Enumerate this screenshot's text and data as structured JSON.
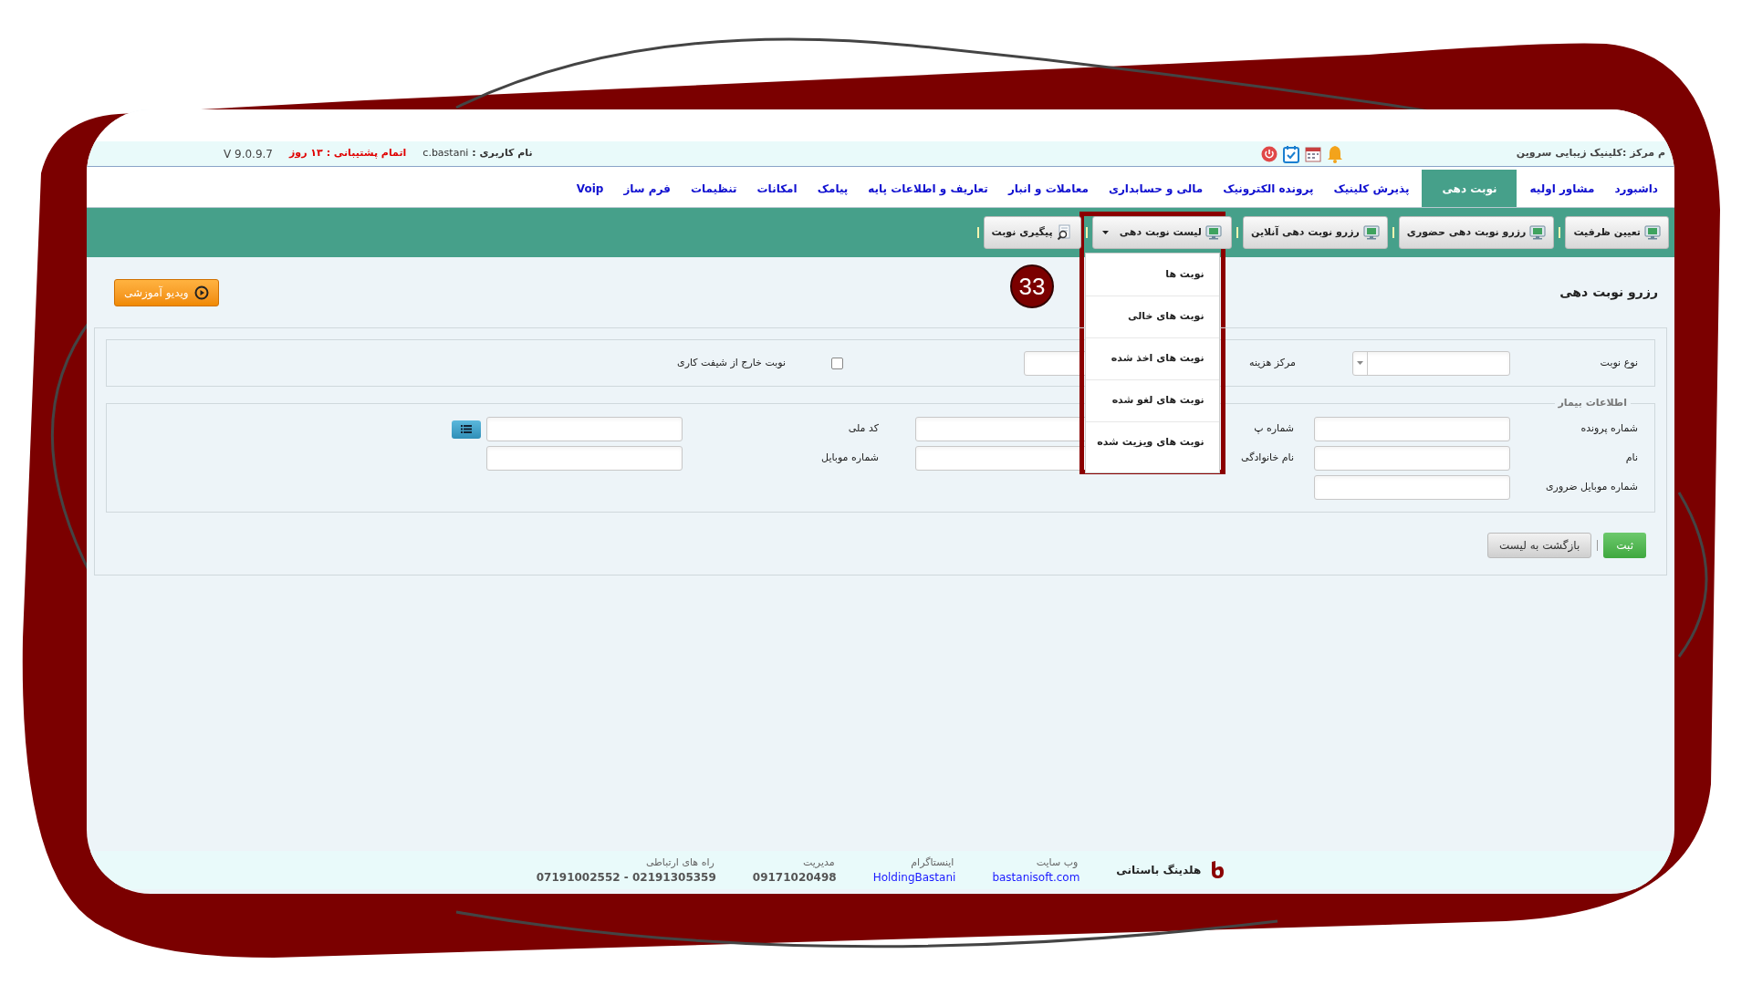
{
  "header": {
    "center_name": "م مرکز :کلینیک زیبایی سروین",
    "username_label": "نام کاربری :",
    "username": "c.bastani",
    "support": "اتمام پشتیبانی : ۱۳ روز",
    "version": "V 9.0.9.7"
  },
  "nav_tabs": [
    {
      "label": "داشبورد",
      "selected": false
    },
    {
      "label": "مشاور اولیه",
      "selected": false
    },
    {
      "label": "نوبت دهی",
      "selected": true
    },
    {
      "label": "پذیرش کلینیک",
      "selected": false
    },
    {
      "label": "پرونده الکترونیک",
      "selected": false
    },
    {
      "label": "مالی و حسابداری",
      "selected": false
    },
    {
      "label": "معاملات و انبار",
      "selected": false
    },
    {
      "label": "تعاریف و اطلاعات پایه",
      "selected": false
    },
    {
      "label": "پیامک",
      "selected": false
    },
    {
      "label": "امکانات",
      "selected": false
    },
    {
      "label": "تنظیمات",
      "selected": false
    },
    {
      "label": "فرم ساز",
      "selected": false
    },
    {
      "label": "Voip",
      "selected": false
    }
  ],
  "toolbar": [
    {
      "label": "تعیین ظرفیت",
      "kind": "monitor"
    },
    {
      "label": "رزرو نوبت دهی حضوری",
      "kind": "monitor"
    },
    {
      "label": "رزرو نوبت دهی آنلاین",
      "kind": "monitor"
    },
    {
      "label": "لیست نوبت دهی",
      "kind": "dropdown",
      "expanded": true
    },
    {
      "label": "پیگیری نوبت",
      "kind": "lookup"
    }
  ],
  "dropdown_menu": [
    "نوبت ها",
    "نوبت های خالی",
    "نوبت های اخذ شده",
    "نوبت های لغو شده",
    "نوبت های ویزیت شده"
  ],
  "step_badge": "33",
  "page_title": "رزرو نوبت دهی",
  "video_button": "ویدیو آموزشی",
  "filter": [
    {
      "label": "نوع نوبت",
      "kind": "select"
    },
    {
      "label": "مرکز هزینه",
      "kind": "text"
    },
    {
      "label": "نوبت خارج از شیفت کاری",
      "kind": "checkbox",
      "checked": false
    }
  ],
  "patient": {
    "legend": "اطلاعات بیمار",
    "rows": [
      [
        {
          "label": "شماره پرونده",
          "kind": "text"
        },
        {
          "label": "شماره پ",
          "kind": "text"
        },
        {
          "label": "کد ملی",
          "kind": "lookup"
        }
      ],
      [
        {
          "label": "نام",
          "kind": "text"
        },
        {
          "label": "نام خانوادگی",
          "kind": "text"
        },
        {
          "label": "شماره موبایل",
          "kind": "text"
        }
      ],
      [
        {
          "label": "شماره موبایل ضروری",
          "kind": "text"
        }
      ]
    ]
  },
  "actions": [
    {
      "label": "ثبت",
      "kind": "primary"
    },
    {
      "label": "بازگشت به لیست",
      "kind": "secondary"
    }
  ],
  "footer": {
    "company": "هلدینگ باستانی",
    "contacts": [
      {
        "label": "وب سایت",
        "value": "bastanisoft.com",
        "kind": "link"
      },
      {
        "label": "اینستاگرام",
        "value": "HoldingBastani",
        "kind": "link"
      },
      {
        "label": "مدیریت",
        "value": "09171020498",
        "kind": "text"
      },
      {
        "label": "راه های ارتباطی",
        "value": "07191002552 - 02191305359",
        "kind": "text"
      }
    ]
  }
}
